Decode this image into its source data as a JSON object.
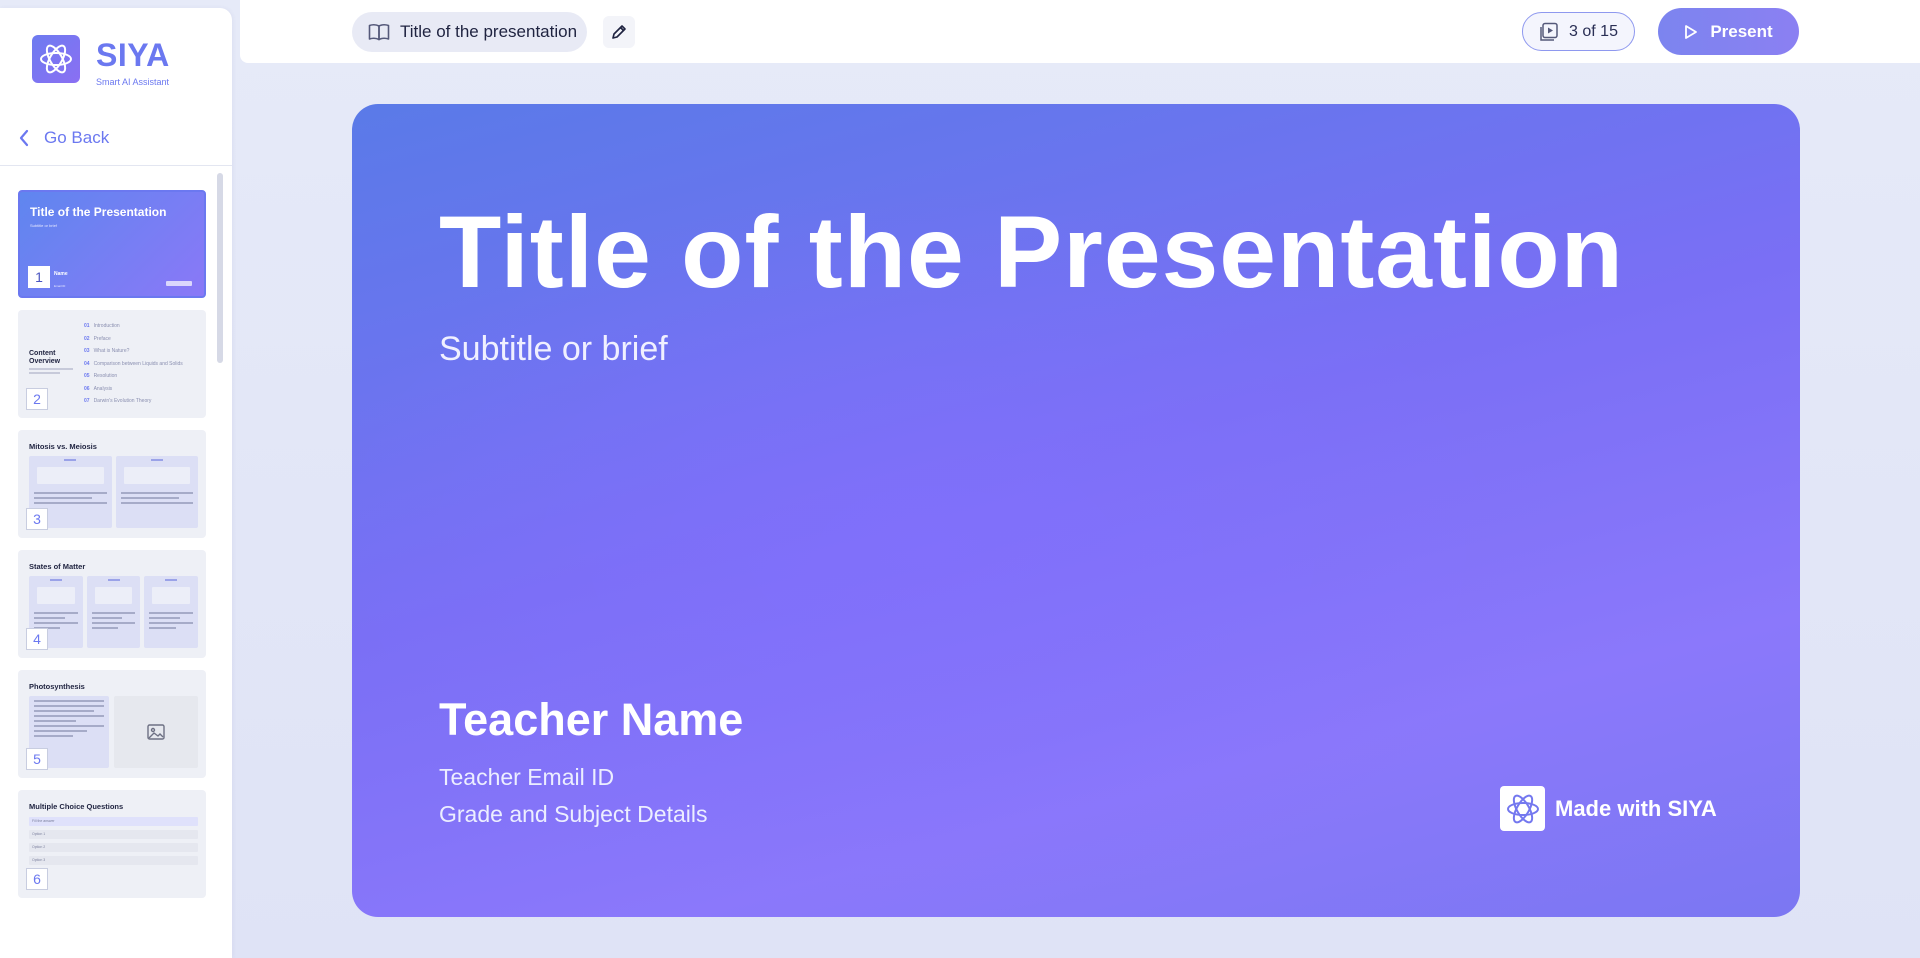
{
  "brand": {
    "name": "SIYA",
    "tagline": "Smart AI Assistant"
  },
  "sidebar": {
    "go_back": "Go Back",
    "slides": [
      {
        "number": "1",
        "title": "Title of the Presentation",
        "subtitle": "Subtitle or brief",
        "name": "Name",
        "email": "Email ID"
      },
      {
        "number": "2",
        "title": "Content Overview",
        "items": [
          {
            "n": "01",
            "label": "Introduction"
          },
          {
            "n": "02",
            "label": "Preface"
          },
          {
            "n": "03",
            "label": "What is Nature?"
          },
          {
            "n": "04",
            "label": "Comparison between Liquids and Solids"
          },
          {
            "n": "05",
            "label": "Resolution"
          },
          {
            "n": "06",
            "label": "Analysis"
          },
          {
            "n": "07",
            "label": "Darwin's Evolution Theory"
          }
        ]
      },
      {
        "number": "3",
        "title": "Mitosis vs. Meiosis"
      },
      {
        "number": "4",
        "title": "States of Matter"
      },
      {
        "number": "5",
        "title": "Photosynthesis"
      },
      {
        "number": "6",
        "title": "Multiple Choice Questions",
        "options": [
          "Fill the answer",
          "Option 1",
          "Option 2",
          "Option 3"
        ]
      }
    ]
  },
  "topbar": {
    "presentation_title": "Title of the presentation",
    "slide_counter": "3 of 15",
    "present_label": "Present"
  },
  "slide": {
    "title": "Title of the Presentation",
    "subtitle": "Subtitle or brief",
    "teacher_name": "Teacher Name",
    "teacher_email": "Teacher Email ID",
    "grade_subject": "Grade and Subject Details",
    "made_with": "Made with SIYA"
  },
  "icons": {
    "logo": "atom-icon",
    "back": "chevron-left-icon",
    "title": "book-icon",
    "edit": "pencil-icon",
    "counter": "slides-icon",
    "present": "play-icon",
    "image_placeholder": "image-icon"
  },
  "colors": {
    "accent": "#6b78f0",
    "slide_gradient_start": "#5a7ae8",
    "slide_gradient_end": "#8b78fb"
  }
}
